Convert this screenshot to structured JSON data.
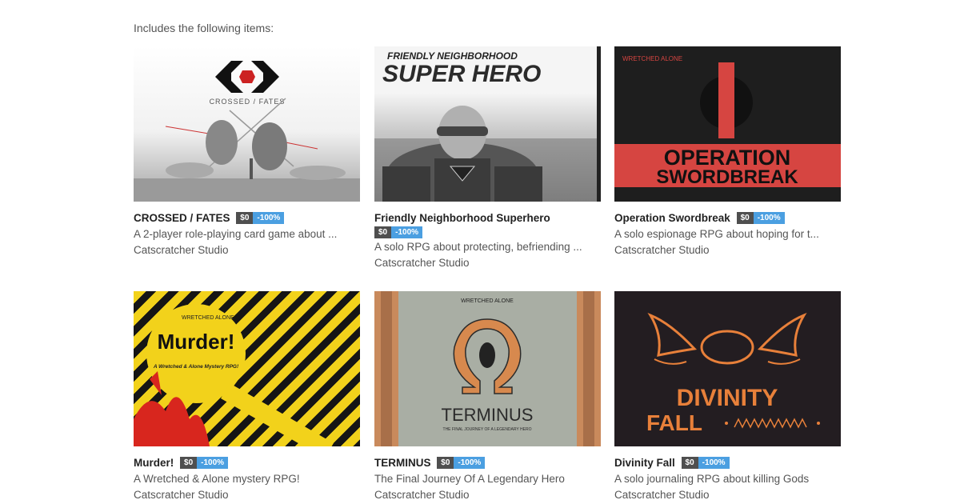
{
  "intro": "Includes the following items:",
  "items": [
    {
      "title": "CROSSED / FATES",
      "price": "$0",
      "discount": "-100%",
      "description": "A 2-player role-playing card game about ...",
      "author": "Catscratcher Studio",
      "cover_text": "CROSSED / FATES"
    },
    {
      "title": "Friendly Neighborhood Superhero",
      "price": "$0",
      "discount": "-100%",
      "description": "A solo RPG about protecting, befriending ...",
      "author": "Catscratcher Studio",
      "cover_text": "FRIENDLY NEIGHBORHOOD",
      "cover_text_2": "SUPER HERO"
    },
    {
      "title": "Operation Swordbreak",
      "price": "$0",
      "discount": "-100%",
      "description": "A solo espionage RPG about hoping for t...",
      "author": "Catscratcher Studio",
      "cover_text": "OPERATION",
      "cover_text_2": "SWORDBREAK",
      "cover_logo": "WRETCHED ALONE"
    },
    {
      "title": "Murder!",
      "price": "$0",
      "discount": "-100%",
      "description": "A Wretched & Alone mystery RPG!",
      "author": "Catscratcher Studio",
      "cover_text": "Murder!",
      "cover_text_2": "A Wretched & Alone Mystery RPG!",
      "cover_logo": "WRETCHED ALONE"
    },
    {
      "title": "TERMINUS",
      "price": "$0",
      "discount": "-100%",
      "description": "The Final Journey Of A Legendary Hero",
      "author": "Catscratcher Studio",
      "cover_text": "TERMINUS",
      "cover_text_2": "THE FINAL JOURNEY OF A LEGENDARY HERO",
      "cover_logo": "WRETCHED ALONE"
    },
    {
      "title": "Divinity Fall",
      "price": "$0",
      "discount": "-100%",
      "description": "A solo journaling RPG about killing Gods",
      "author": "Catscratcher Studio",
      "cover_text": "DIVINITY",
      "cover_text_2": "FALL"
    }
  ],
  "colors": {
    "price_badge": "#4f4f4f",
    "discount_badge": "#4b9fe1",
    "swordbreak_red": "#d64541",
    "murder_yellow": "#f2d21b",
    "divinity_orange": "#e8803a",
    "terminus_bg": "#a9aea4"
  }
}
